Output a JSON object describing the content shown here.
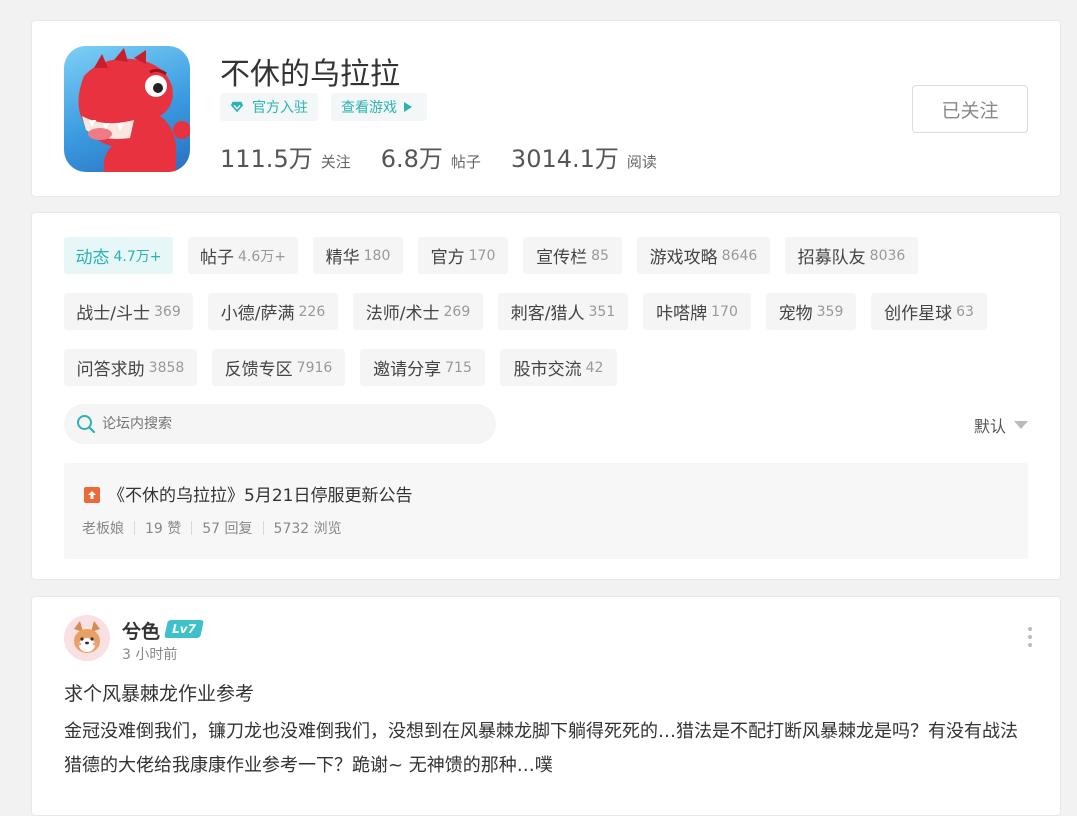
{
  "header": {
    "title": "不休的乌拉拉",
    "tag_official": "官方入驻",
    "tag_game": "查看游戏",
    "stats": [
      {
        "value": "111.5万",
        "label": "关注"
      },
      {
        "value": "6.8万",
        "label": "帖子"
      },
      {
        "value": "3014.1万",
        "label": "阅读"
      }
    ],
    "follow_label": "已关注"
  },
  "categories": [
    {
      "label": "动态",
      "count": "4.7万+"
    },
    {
      "label": "帖子",
      "count": "4.6万+"
    },
    {
      "label": "精华",
      "count": "180"
    },
    {
      "label": "官方",
      "count": "170"
    },
    {
      "label": "宣传栏",
      "count": "85"
    },
    {
      "label": "游戏攻略",
      "count": "8646"
    },
    {
      "label": "招募队友",
      "count": "8036"
    },
    {
      "label": "战士/斗士",
      "count": "369"
    },
    {
      "label": "小德/萨满",
      "count": "226"
    },
    {
      "label": "法师/术士",
      "count": "269"
    },
    {
      "label": "刺客/猎人",
      "count": "351"
    },
    {
      "label": "咔嗒牌",
      "count": "170"
    },
    {
      "label": "宠物",
      "count": "359"
    },
    {
      "label": "创作星球",
      "count": "63"
    },
    {
      "label": "问答求助",
      "count": "3858"
    },
    {
      "label": "反馈专区",
      "count": "7916"
    },
    {
      "label": "邀请分享",
      "count": "715"
    },
    {
      "label": "股市交流",
      "count": "42"
    }
  ],
  "search": {
    "placeholder": "论坛内搜索"
  },
  "sort": {
    "label": "默认"
  },
  "notice": {
    "title": "《不休的乌拉拉》5月21日停服更新公告",
    "author": "老板娘",
    "likes": "19 赞",
    "replies": "57 回复",
    "views": "5732 浏览"
  },
  "post": {
    "username": "兮色",
    "level": "Lv7",
    "time": "3 小时前",
    "title": "求个风暴棘龙作业参考",
    "body": "金冠没难倒我们，镰刀龙也没难倒我们，没想到在风暴棘龙脚下躺得死死的…猎法是不配打断风暴棘龙是吗？有没有战法猎德的大佬给我康康作业参考一下？跪谢~ 无神馈的那种…噗"
  },
  "colors": {
    "accent": "#2bb3b3",
    "level_badge": "#3ec1c8",
    "notice_badge": "#ea6a3a",
    "dino": "#e8323f"
  }
}
